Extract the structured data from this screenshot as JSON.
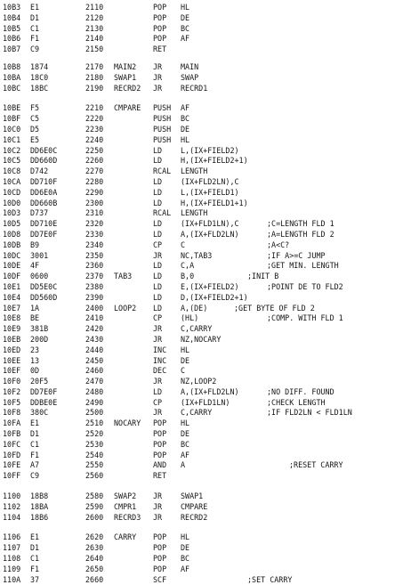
{
  "listing": {
    "groups": [
      [
        [
          "10B3",
          "E1",
          "2110",
          "",
          "POP",
          "HL",
          ""
        ],
        [
          "10B4",
          "D1",
          "2120",
          "",
          "POP",
          "DE",
          ""
        ],
        [
          "10B5",
          "C1",
          "2130",
          "",
          "POP",
          "BC",
          ""
        ],
        [
          "10B6",
          "F1",
          "2140",
          "",
          "POP",
          "AF",
          ""
        ],
        [
          "10B7",
          "C9",
          "2150",
          "",
          "RET",
          "",
          ""
        ]
      ],
      [
        [
          "10B8",
          "1874",
          "2170",
          "MAIN2",
          "JR",
          "MAIN",
          ""
        ],
        [
          "10BA",
          "18C0",
          "2180",
          "SWAP1",
          "JR",
          "SWAP",
          ""
        ],
        [
          "10BC",
          "18BC",
          "2190",
          "RECRD2",
          "JR",
          "RECRD1",
          ""
        ]
      ],
      [
        [
          "10BE",
          "F5",
          "2210",
          "CMPARE",
          "PUSH",
          "AF",
          ""
        ],
        [
          "10BF",
          "C5",
          "2220",
          "",
          "PUSH",
          "BC",
          ""
        ],
        [
          "10C0",
          "D5",
          "2230",
          "",
          "PUSH",
          "DE",
          ""
        ],
        [
          "10C1",
          "E5",
          "2240",
          "",
          "PUSH",
          "HL",
          ""
        ],
        [
          "10C2",
          "DD6E0C",
          "2250",
          "",
          "LD",
          "L,(IX+FIELD2)",
          ""
        ],
        [
          "10C5",
          "DD660D",
          "2260",
          "",
          "LD",
          "H,(IX+FIELD2+1)",
          ""
        ],
        [
          "10C8",
          "D742",
          "2270",
          "",
          "RCAL",
          "LENGTH",
          ""
        ],
        [
          "10CA",
          "DD710F",
          "2280",
          "",
          "LD",
          "(IX+FLD2LN),C",
          ""
        ],
        [
          "10CD",
          "DD6E0A",
          "2290",
          "",
          "LD",
          "L,(IX+FIELD1)",
          ""
        ],
        [
          "10D0",
          "DD660B",
          "2300",
          "",
          "LD",
          "H,(IX+FIELD1+1)",
          ""
        ],
        [
          "10D3",
          "D737",
          "2310",
          "",
          "RCAL",
          "LENGTH",
          ""
        ],
        [
          "10D5",
          "DD710E",
          "2320",
          "",
          "LD",
          "(IX+FLD1LN),C",
          "c:;C=LENGTH FLD 1"
        ],
        [
          "10D8",
          "DD7E0F",
          "2330",
          "",
          "LD",
          "A,(IX+FLD2LN)",
          "c:;A=LENGTH FLD 2"
        ],
        [
          "10DB",
          "B9",
          "2340",
          "",
          "CP",
          "C",
          "c:;A<C?"
        ],
        [
          "10DC",
          "3001",
          "2350",
          "",
          "JR",
          "NC,TAB3",
          "c:;IF A>=C JUMP"
        ],
        [
          "10DE",
          "4F",
          "2360",
          "",
          "LD",
          "C,A",
          "c:;GET MIN. LENGTH"
        ],
        [
          "10DF",
          "0600",
          "2370",
          "TAB3",
          "LD",
          "B,0",
          "l:;INIT B"
        ],
        [
          "10E1",
          "DD5E0C",
          "2380",
          "",
          "LD",
          "E,(IX+FIELD2)",
          "c:;POINT DE TO FLD2"
        ],
        [
          "10E4",
          "DD560D",
          "2390",
          "",
          "LD",
          "D,(IX+FIELD2+1)",
          ""
        ],
        [
          "10E7",
          "1A",
          "2400",
          "LOOP2",
          "LD",
          "A,(DE)",
          "m:;GET BYTE OF FLD 2"
        ],
        [
          "10E8",
          "BE",
          "2410",
          "",
          "CP",
          "(HL)",
          "c:;COMP. WITH FLD 1"
        ],
        [
          "10E9",
          "381B",
          "2420",
          "",
          "JR",
          "C,CARRY",
          ""
        ],
        [
          "10EB",
          "200D",
          "2430",
          "",
          "JR",
          "NZ,NOCARY",
          ""
        ],
        [
          "10ED",
          "23",
          "2440",
          "",
          "INC",
          "HL",
          ""
        ],
        [
          "10EE",
          "13",
          "2450",
          "",
          "INC",
          "DE",
          ""
        ],
        [
          "10EF",
          "0D",
          "2460",
          "",
          "DEC",
          "C",
          ""
        ],
        [
          "10F0",
          "20F5",
          "2470",
          "",
          "JR",
          "NZ,LOOP2",
          ""
        ],
        [
          "10F2",
          "DD7E0F",
          "2480",
          "",
          "LD",
          "A,(IX+FLD2LN)",
          "c:;NO DIFF. FOUND"
        ],
        [
          "10F5",
          "DDBE0E",
          "2490",
          "",
          "CP",
          "(IX+FLD1LN)",
          "c:;CHECK LENGTH"
        ],
        [
          "10F8",
          "380C",
          "2500",
          "",
          "JR",
          "C,CARRY",
          "c:;IF FLD2LN < FLD1LN"
        ],
        [
          "10FA",
          "E1",
          "2510",
          "NOCARY",
          "POP",
          "HL",
          ""
        ],
        [
          "10FB",
          "D1",
          "2520",
          "",
          "POP",
          "DE",
          ""
        ],
        [
          "10FC",
          "C1",
          "2530",
          "",
          "POP",
          "BC",
          ""
        ],
        [
          "10FD",
          "F1",
          "2540",
          "",
          "POP",
          "AF",
          ""
        ],
        [
          "10FE",
          "A7",
          "2550",
          "",
          "AND",
          "A",
          "r:;RESET CARRY"
        ],
        [
          "10FF",
          "C9",
          "2560",
          "",
          "RET",
          "",
          ""
        ]
      ],
      [
        [
          "1100",
          "18B8",
          "2580",
          "SWAP2",
          "JR",
          "SWAP1",
          ""
        ],
        [
          "1102",
          "18BA",
          "2590",
          "CMPR1",
          "JR",
          "CMPARE",
          ""
        ],
        [
          "1104",
          "18B6",
          "2600",
          "RECRD3",
          "JR",
          "RECRD2",
          ""
        ]
      ],
      [
        [
          "1106",
          "E1",
          "2620",
          "CARRY",
          "POP",
          "HL",
          ""
        ],
        [
          "1107",
          "D1",
          "2630",
          "",
          "POP",
          "DE",
          ""
        ],
        [
          "1108",
          "C1",
          "2640",
          "",
          "POP",
          "BC",
          ""
        ],
        [
          "1109",
          "F1",
          "2650",
          "",
          "POP",
          "AF",
          ""
        ],
        [
          "110A",
          "37",
          "2660",
          "",
          "SCF",
          "",
          "l:;SET CARRY"
        ]
      ]
    ]
  }
}
